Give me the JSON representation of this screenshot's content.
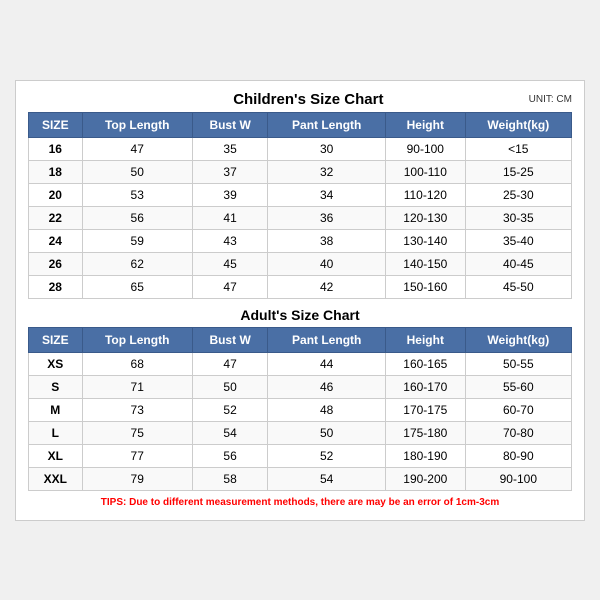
{
  "chart": {
    "mainTitle": "Children's Size Chart",
    "unitLabel": "UNIT: CM",
    "adultTitle": "Adult's Size Chart",
    "tips": "TIPS: Due to different measurement methods, there are may be an error of 1cm-3cm",
    "columns": [
      "SIZE",
      "Top Length",
      "Bust W",
      "Pant Length",
      "Height",
      "Weight(kg)"
    ],
    "childrenRows": [
      [
        "16",
        "47",
        "35",
        "30",
        "90-100",
        "<15"
      ],
      [
        "18",
        "50",
        "37",
        "32",
        "100-110",
        "15-25"
      ],
      [
        "20",
        "53",
        "39",
        "34",
        "110-120",
        "25-30"
      ],
      [
        "22",
        "56",
        "41",
        "36",
        "120-130",
        "30-35"
      ],
      [
        "24",
        "59",
        "43",
        "38",
        "130-140",
        "35-40"
      ],
      [
        "26",
        "62",
        "45",
        "40",
        "140-150",
        "40-45"
      ],
      [
        "28",
        "65",
        "47",
        "42",
        "150-160",
        "45-50"
      ]
    ],
    "adultRows": [
      [
        "XS",
        "68",
        "47",
        "44",
        "160-165",
        "50-55"
      ],
      [
        "S",
        "71",
        "50",
        "46",
        "160-170",
        "55-60"
      ],
      [
        "M",
        "73",
        "52",
        "48",
        "170-175",
        "60-70"
      ],
      [
        "L",
        "75",
        "54",
        "50",
        "175-180",
        "70-80"
      ],
      [
        "XL",
        "77",
        "56",
        "52",
        "180-190",
        "80-90"
      ],
      [
        "XXL",
        "79",
        "58",
        "54",
        "190-200",
        "90-100"
      ]
    ]
  }
}
